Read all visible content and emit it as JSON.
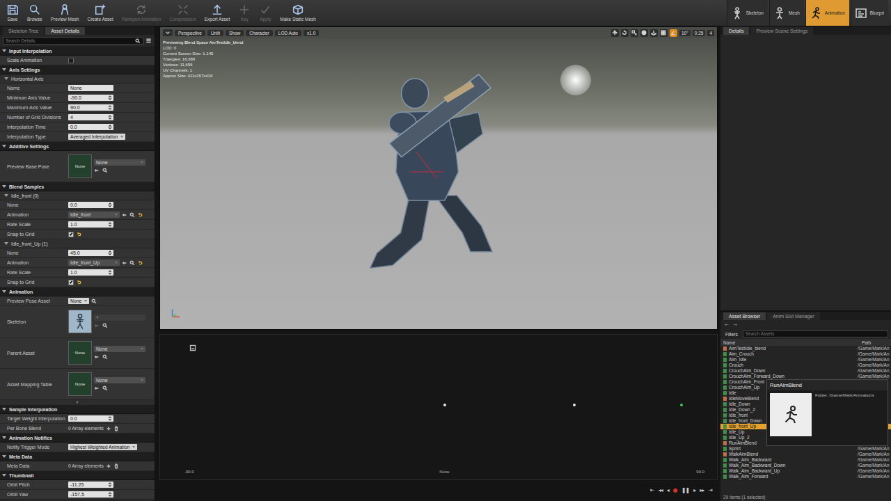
{
  "toolbar": {
    "buttons": [
      {
        "label": "Save",
        "kind": "save",
        "disabled": false
      },
      {
        "label": "Browse",
        "kind": "browse",
        "disabled": false
      },
      {
        "label": "Preview Mesh",
        "kind": "mesh",
        "disabled": false
      },
      {
        "label": "Create Asset",
        "kind": "create",
        "disabled": false
      },
      {
        "label": "Reimport Animation",
        "kind": "reimport",
        "disabled": true
      },
      {
        "label": "Compression",
        "kind": "compress",
        "disabled": true
      },
      {
        "label": "Export Asset",
        "kind": "export",
        "disabled": false
      },
      {
        "label": "Key",
        "kind": "key",
        "disabled": true
      },
      {
        "label": "Apply",
        "kind": "apply",
        "disabled": true
      },
      {
        "label": "Make Static Mesh",
        "kind": "static",
        "disabled": false
      }
    ]
  },
  "modes": [
    {
      "label": "Skeleton",
      "kind": "skeleton",
      "selected": false
    },
    {
      "label": "Mesh",
      "kind": "figure",
      "selected": false
    },
    {
      "label": "Animation",
      "kind": "running",
      "selected": true
    },
    {
      "label": "Bluepri",
      "kind": "blueprint",
      "selected": false
    }
  ],
  "details": {
    "tabs": [
      {
        "label": "Skeleton Tree",
        "selected": false
      },
      {
        "label": "Asset Details",
        "selected": true
      }
    ],
    "search": {
      "placeholder": "Search Details"
    },
    "sections": [
      {
        "title": "Input Interpolation",
        "rows": [
          {
            "kind": "checkbox",
            "label": "Scale Animation",
            "checked": false
          }
        ]
      },
      {
        "title": "Axis Settings",
        "rows": [
          {
            "kind": "subheader",
            "label": "Horizontal Axis"
          },
          {
            "kind": "text",
            "label": "Name",
            "value": "None"
          },
          {
            "kind": "number",
            "label": "Minimum Axis Value",
            "value": "-90.0"
          },
          {
            "kind": "number",
            "label": "Maximum Axis Value",
            "value": "90.0"
          },
          {
            "kind": "number",
            "label": "Number of Grid Divisions",
            "value": "4"
          },
          {
            "kind": "number",
            "label": "Interpolation Time",
            "value": "0.0"
          },
          {
            "kind": "dropdown",
            "label": "Interpolation Type",
            "value": "Averaged Interpolation"
          }
        ]
      },
      {
        "title": "Additive Settings",
        "rows": [
          {
            "kind": "asset",
            "label": "Preview Base Pose",
            "thumb": "None",
            "value": "None"
          }
        ]
      },
      {
        "title": "Blend Samples",
        "rows": [
          {
            "kind": "subheader",
            "label": "Idle_front (0)"
          },
          {
            "kind": "number",
            "label": "None",
            "value": "0.0"
          },
          {
            "kind": "combo",
            "label": "Animation",
            "value": "Idle_front"
          },
          {
            "kind": "number",
            "label": "Rate Scale",
            "value": "1.0"
          },
          {
            "kind": "checkbox",
            "label": "Snap to Grid",
            "checked": true
          },
          {
            "kind": "subheader",
            "label": "Idle_front_Up (1)"
          },
          {
            "kind": "number",
            "label": "None",
            "value": "45.0"
          },
          {
            "kind": "combo",
            "label": "Animation",
            "value": "Idle_front_Up"
          },
          {
            "kind": "number",
            "label": "Rate Scale",
            "value": "1.0"
          },
          {
            "kind": "checkbox",
            "label": "Snap to Grid",
            "checked": true
          }
        ]
      },
      {
        "title": "Animation",
        "rows": [
          {
            "kind": "dropdown",
            "label": "Preview Pose Asset",
            "value": "None"
          },
          {
            "kind": "skeleton",
            "label": "Skeleton"
          },
          {
            "kind": "asset",
            "label": "Parent Asset",
            "thumb": "None",
            "value": "None"
          },
          {
            "kind": "asset",
            "label": "Asset Mapping Table",
            "thumb": "None",
            "value": "None"
          }
        ]
      },
      {
        "title": "Sample Interpolation",
        "rows": [
          {
            "kind": "number",
            "label": "Target Weight Interpolation",
            "value": "0.0"
          },
          {
            "kind": "array",
            "label": "Per Bone Blend",
            "value": "0 Array elements"
          }
        ]
      },
      {
        "title": "Animation Notifies",
        "rows": [
          {
            "kind": "dropdown",
            "label": "Notify Trigger Mode",
            "value": "Highest Weighted Animation"
          }
        ]
      },
      {
        "title": "Meta Data",
        "rows": [
          {
            "kind": "array",
            "label": "Meta Data",
            "value": "0 Array elements"
          }
        ]
      },
      {
        "title": "Thumbnail",
        "rows": [
          {
            "kind": "number",
            "label": "Orbit Pitch",
            "value": "-11.25"
          },
          {
            "kind": "number",
            "label": "Orbit Yaw",
            "value": "-157.5"
          }
        ]
      }
    ]
  },
  "viewport": {
    "buttons": [
      "Perspective",
      "Unlit",
      "Show",
      "Character",
      "LOD Auto",
      "x1.0"
    ],
    "tools": [
      {
        "kind": "translate",
        "active": false
      },
      {
        "kind": "rotate",
        "active": false
      },
      {
        "kind": "scale",
        "active": false
      },
      {
        "kind": "world",
        "active": false
      },
      {
        "kind": "surface",
        "active": false
      },
      {
        "kind": "grid",
        "active": false
      },
      {
        "kind": "angle",
        "active": true
      }
    ],
    "snaps": [
      "10°",
      "0.25",
      "4"
    ],
    "stats": [
      "Previewing Blend Space AimTestIdle_blend",
      "LOD: 0",
      "Current Screen Size: 1.145",
      "Triangles: 16,688",
      "Vertices: 11,656",
      "UV Channels: 1",
      "Approx Size: 411x157x416"
    ]
  },
  "graph": {
    "ticks": [
      "-90.0",
      "None",
      "90.0"
    ],
    "range": [
      -90,
      90
    ],
    "samples": [
      0,
      45
    ],
    "preview": 82
  },
  "playback": [
    {
      "glyph": "⇤",
      "color": "#c8c8c8"
    },
    {
      "glyph": "◂◂",
      "color": "#c8c8c8"
    },
    {
      "glyph": "◂",
      "color": "#c8c8c8"
    },
    {
      "glyph": "●",
      "color": "#d0342c"
    },
    {
      "glyph": "❚❚",
      "color": "#c8c8c8"
    },
    {
      "glyph": "▸",
      "color": "#c8c8c8"
    },
    {
      "glyph": "▸▸",
      "color": "#c8c8c8"
    },
    {
      "glyph": "⇥",
      "color": "#c8c8c8"
    }
  ],
  "right_tabs": [
    {
      "label": "Details",
      "selected": true
    },
    {
      "label": "Preview Scene Settings",
      "selected": false
    }
  ],
  "asset_browser": {
    "tabs": [
      {
        "label": "Asset Browser",
        "selected": true
      },
      {
        "label": "Anim Slot Manager",
        "selected": false
      }
    ],
    "nav": [
      "←",
      "→"
    ],
    "filters": "Filters",
    "search": {
      "placeholder": "Search Assets"
    },
    "columns": [
      "Name",
      "Path"
    ],
    "assets": [
      {
        "name": "AimTestIdle_blend",
        "path": "/Game/Mark/An",
        "selected": false,
        "color": "#c2703f"
      },
      {
        "name": "Aim_Crouch",
        "path": "/Game/Mark/An",
        "selected": false,
        "color": "#3f9045"
      },
      {
        "name": "Aim_Idle",
        "path": "/Game/Mark/An",
        "selected": false,
        "color": "#3f9045"
      },
      {
        "name": "Crouch",
        "path": "/Game/Mark/An",
        "selected": false,
        "color": "#3f9045"
      },
      {
        "name": "CrouchAim_Down",
        "path": "/Game/Mark/An",
        "selected": false,
        "color": "#3f9045"
      },
      {
        "name": "CrouchAim_Forward_Down",
        "path": "/Game/Mark/An",
        "selected": false,
        "color": "#3f9045"
      },
      {
        "name": "CrouchAim_Front",
        "path": "",
        "selected": false,
        "color": "#3f9045"
      },
      {
        "name": "CrouchAim_Up",
        "path": "",
        "selected": false,
        "color": "#3f9045"
      },
      {
        "name": "Idle",
        "path": "",
        "selected": false,
        "color": "#3f9045"
      },
      {
        "name": "IdleMoveBlend",
        "path": "",
        "selected": false,
        "color": "#c2703f"
      },
      {
        "name": "Idle_Down",
        "path": "",
        "selected": false,
        "color": "#3f9045"
      },
      {
        "name": "Idle_Down_2",
        "path": "",
        "selected": false,
        "color": "#3f9045"
      },
      {
        "name": "Idle_front",
        "path": "",
        "selected": false,
        "color": "#3f9045"
      },
      {
        "name": "Idle_front_Down",
        "path": "",
        "selected": false,
        "color": "#3f9045"
      },
      {
        "name": "Idle_front_Up",
        "path": "",
        "selected": true,
        "color": "#3f9045"
      },
      {
        "name": "Idle_Up",
        "path": "",
        "selected": false,
        "color": "#3f9045"
      },
      {
        "name": "Idle_Up_2",
        "path": "",
        "selected": false,
        "color": "#3f9045"
      },
      {
        "name": "RunAimBlend",
        "path": "",
        "selected": false,
        "color": "#c2703f"
      },
      {
        "name": "Sprint",
        "path": "/Game/Mark/An",
        "selected": false,
        "color": "#3f9045"
      },
      {
        "name": "WalkAimBlend",
        "path": "/Game/Mark/An",
        "selected": false,
        "color": "#c2703f"
      },
      {
        "name": "Walk_Aim_Backward",
        "path": "/Game/Mark/An",
        "selected": false,
        "color": "#3f9045"
      },
      {
        "name": "Walk_Aim_Backward_Down",
        "path": "/Game/Mark/An",
        "selected": false,
        "color": "#3f9045"
      },
      {
        "name": "Walk_Aim_Backward_Up",
        "path": "/Game/Mark/An",
        "selected": false,
        "color": "#3f9045"
      },
      {
        "name": "Walk_Aim_Forward",
        "path": "/Game/Mark/An",
        "selected": false,
        "color": "#3f9045"
      }
    ],
    "tooltip": {
      "title": "RunAimBlend",
      "folder": "Folder: /Game/Mark/Animations"
    },
    "footer": "29 items (1 selected)"
  }
}
